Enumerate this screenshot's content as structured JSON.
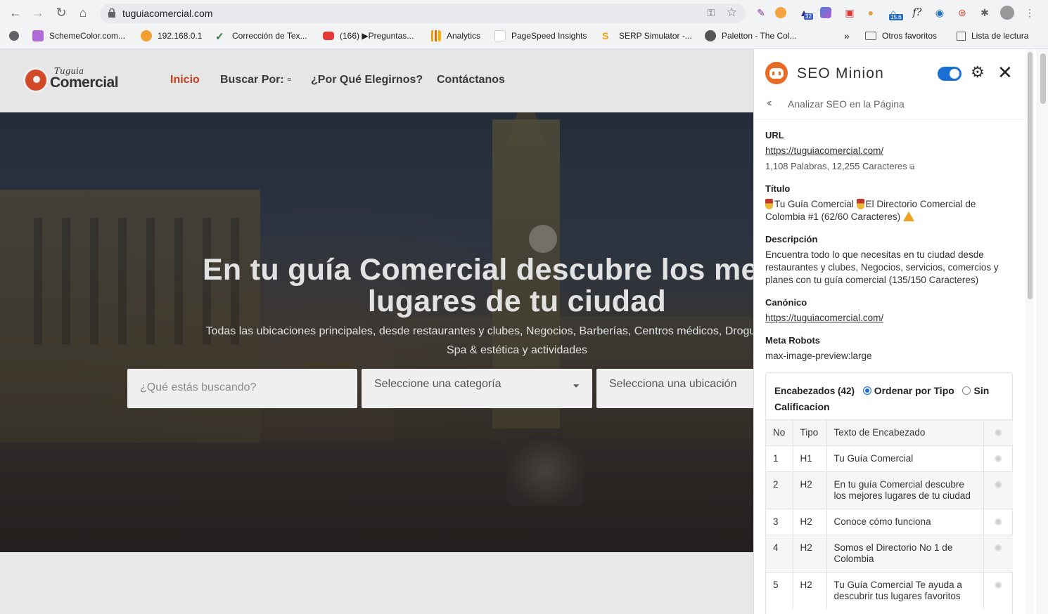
{
  "browser": {
    "url": "tuguiacomercial.com",
    "bookmarks": [
      {
        "label": "SchemeColor.com...",
        "icon": "schemecolor-icon",
        "color": "#b06bd6"
      },
      {
        "label": "192.168.0.1",
        "icon": "router-icon",
        "color": "#f0a030"
      },
      {
        "label": "Corrección de Tex...",
        "icon": "checkmark-icon",
        "color": "#2e7d32"
      },
      {
        "label": "(166) ▶Preguntas...",
        "icon": "youtube-icon",
        "color": "#e53935"
      },
      {
        "label": "Analytics",
        "icon": "analytics-icon",
        "color": "#f4a100"
      },
      {
        "label": "PageSpeed Insights",
        "icon": "pagespeed-icon",
        "color": "#4285f4"
      },
      {
        "label": "SERP Simulator -...",
        "icon": "serp-icon",
        "color": "#555555"
      },
      {
        "label": "Paletton - The Col...",
        "icon": "paletton-icon",
        "color": "#555555"
      }
    ],
    "more": "»",
    "otros": "Otros favoritos",
    "lectura": "Lista de lectura",
    "ext_badges": {
      "a": "32",
      "b": "15.6"
    }
  },
  "site": {
    "logo_top": "Tuguia",
    "logo_main": "Comercial",
    "nav": [
      {
        "label": "Inicio",
        "color": "#c0401f"
      },
      {
        "label": "Buscar Por: ▫",
        "color": "#3a3a3a"
      },
      {
        "label": "¿Por Qué Elegirnos?",
        "color": "#3a3a3a"
      },
      {
        "label": "Contáctanos",
        "color": "#3a3a3a"
      }
    ],
    "hero_title_1": "En tu guía Comercial descubre los mejores",
    "hero_title_2": "lugares de tu ciudad",
    "hero_sub_1": "Todas las ubicaciones principales, desde restaurantes y clubes, Negocios, Barberías, Centros médicos, Droguerías, Hoteles,",
    "hero_sub_2": "Spa & estética y actividades",
    "search_placeholder": "¿Qué estás buscando?",
    "category_select": "Seleccione una categoría",
    "location_select": "Selecciona una ubicación"
  },
  "panel": {
    "title": "SEO Minion",
    "back_label": "Analizar SEO en la Página",
    "url_label": "URL",
    "url_value": "https://tuguiacomercial.com/",
    "stats": "1,108 Palabras, 12,255 Caracteres",
    "title_label": "Título",
    "title_value_a": "Tu Guía Comercial",
    "title_value_b": "El Directorio Comercial de Colombia #1 (62/60 Caracteres)",
    "desc_label": "Descripción",
    "desc_value": "Encuentra todo lo que necesitas en tu ciudad desde restaurantes y clubes, Negocios, servicios, comercios y planes con tu guía comercial (135/150 Caracteres)",
    "canon_label": "Canónico",
    "canon_value": "https://tuguiacomercial.com/",
    "robots_label": "Meta Robots",
    "robots_value": "max-image-preview:large",
    "headings_label": "Encabezados (42)",
    "sort_type": "Ordenar por Tipo",
    "sort_none_a": "Sin",
    "sort_none_b": "Calificacion",
    "cols": [
      "No",
      "Tipo",
      "Texto de Encabezado"
    ],
    "rows": [
      {
        "no": "1",
        "tipo": "H1",
        "texto": "Tu Guía Comercial"
      },
      {
        "no": "2",
        "tipo": "H2",
        "texto": "En tu guía Comercial descubre los mejores lugares de tu ciudad"
      },
      {
        "no": "3",
        "tipo": "H2",
        "texto": "Conoce cómo funciona"
      },
      {
        "no": "4",
        "tipo": "H2",
        "texto": "Somos el Directorio No 1 de Colombia"
      },
      {
        "no": "5",
        "tipo": "H2",
        "texto": "Tu Guía Comercial Te ayuda a descubrir tus lugares favoritos"
      }
    ]
  }
}
